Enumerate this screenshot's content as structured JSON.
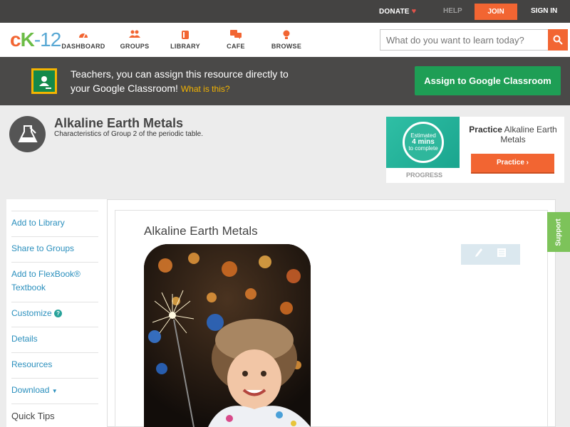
{
  "topbar": {
    "donate": "DONATE",
    "help": "HELP",
    "join": "JOIN",
    "signin": "SIGN IN"
  },
  "logo": {
    "c": "c",
    "k": "K",
    "n": "-12"
  },
  "nav": [
    {
      "label": "DASHBOARD",
      "icon": "dashboard-icon"
    },
    {
      "label": "GROUPS",
      "icon": "groups-icon"
    },
    {
      "label": "LIBRARY",
      "icon": "library-icon"
    },
    {
      "label": "CAFE",
      "icon": "cafe-icon"
    },
    {
      "label": "BROWSE",
      "icon": "browse-icon"
    }
  ],
  "search": {
    "placeholder": "What do you want to learn today?"
  },
  "banner": {
    "line1": "Teachers, you can assign this resource directly to",
    "line2": "your Google Classroom!",
    "what": "What is this?",
    "button": "Assign to Google Classroom"
  },
  "concept": {
    "title": "Alkaline Earth Metals",
    "subtitle": "Characteristics of Group 2 of the periodic table."
  },
  "practice": {
    "estimated": "Estimated",
    "mins": "4 mins",
    "to_complete": "to complete",
    "progress_label": "PROGRESS",
    "prefix": "Practice",
    "name": "Alkaline Earth Metals",
    "button": "Practice"
  },
  "sidebar": {
    "items": [
      "Add to Library",
      "Share to Groups",
      "Add to FlexBook®",
      "Textbook",
      "Customize",
      "Details",
      "Resources",
      "Download"
    ],
    "quick_tips": "Quick Tips"
  },
  "content": {
    "title": "Alkaline Earth Metals"
  },
  "support": "Support",
  "colors": {
    "accent": "#f26532",
    "brand_green": "#1e9e55",
    "link": "#2a8fbd"
  }
}
